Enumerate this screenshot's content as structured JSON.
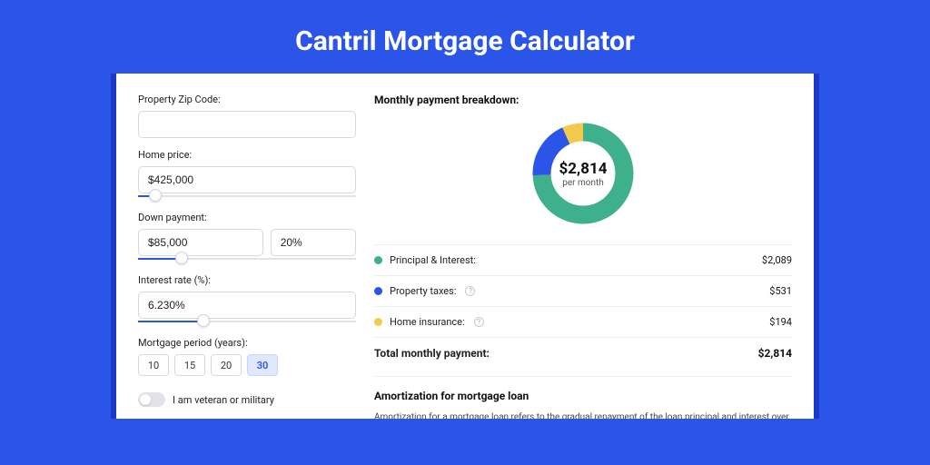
{
  "title": "Cantril Mortgage Calculator",
  "colors": {
    "green": "#3eb08b",
    "blue": "#2a55e8",
    "yellow": "#f3c94e"
  },
  "form": {
    "zip": {
      "label": "Property Zip Code:",
      "value": ""
    },
    "home_price": {
      "label": "Home price:",
      "value": "$425,000",
      "slider_pct": 8
    },
    "down_payment": {
      "label": "Down payment:",
      "amount": "$85,000",
      "percent": "20%",
      "slider_pct": 20
    },
    "interest": {
      "label": "Interest rate (%):",
      "value": "6.230%",
      "slider_pct": 30
    },
    "period": {
      "label": "Mortgage period (years):",
      "options": [
        "10",
        "15",
        "20",
        "30"
      ],
      "selected": "30"
    },
    "veteran": {
      "label": "I am veteran or military",
      "on": false
    }
  },
  "breakdown": {
    "title": "Monthly payment breakdown:",
    "center_amount": "$2,814",
    "center_sub": "per month",
    "items": [
      {
        "label": "Principal & Interest:",
        "value": "$2,089",
        "color": "green",
        "info": false,
        "num": 2089
      },
      {
        "label": "Property taxes:",
        "value": "$531",
        "color": "blue",
        "info": true,
        "num": 531
      },
      {
        "label": "Home insurance:",
        "value": "$194",
        "color": "yellow",
        "info": true,
        "num": 194
      }
    ],
    "total": {
      "label": "Total monthly payment:",
      "value": "$2,814",
      "num": 2814
    }
  },
  "amortization": {
    "title": "Amortization for mortgage loan",
    "text": "Amortization for a mortgage loan refers to the gradual repayment of the loan principal and interest over a specified"
  },
  "chart_data": {
    "type": "pie",
    "title": "Monthly payment breakdown",
    "categories": [
      "Principal & Interest",
      "Property taxes",
      "Home insurance"
    ],
    "values": [
      2089,
      531,
      194
    ],
    "colors": [
      "#3eb08b",
      "#2a55e8",
      "#f3c94e"
    ],
    "total": 2814,
    "center_label": "$2,814 per month"
  }
}
